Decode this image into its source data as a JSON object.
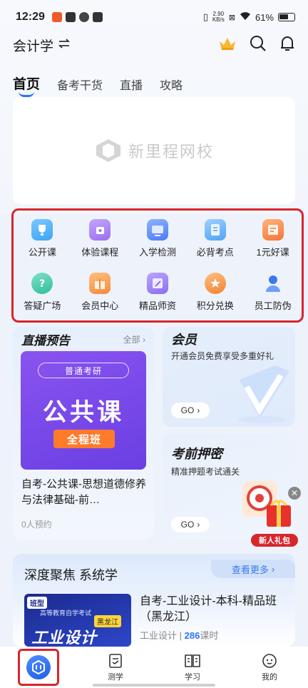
{
  "status_bar": {
    "time": "12:29",
    "net_speed_value": "2.90",
    "net_speed_unit": "KB/s",
    "battery": "61%"
  },
  "header": {
    "subject": "会计学",
    "switch_icon": "swap-arrows-icon",
    "icons": [
      "crown-icon",
      "search-icon",
      "bell-icon"
    ],
    "accent": "#2d72ff"
  },
  "tabs": [
    "首页",
    "备考干货",
    "直播",
    "攻略"
  ],
  "banner": {
    "logo_text": "新里程网校"
  },
  "shortcuts": [
    {
      "label": "公开课",
      "icon": "trophy-icon",
      "color": "#3aa6f5"
    },
    {
      "label": "体验课程",
      "icon": "bag-icon",
      "color": "#9b6ef0"
    },
    {
      "label": "入学检测",
      "icon": "monitor-icon",
      "color": "#4a7bf5"
    },
    {
      "label": "必背考点",
      "icon": "document-icon",
      "color": "#4fa3f6"
    },
    {
      "label": "1元好课",
      "icon": "coupon-icon",
      "color": "#f7763a"
    },
    {
      "label": "答疑广场",
      "icon": "question-bubble-icon",
      "color": "#2fbf9c"
    },
    {
      "label": "会员中心",
      "icon": "gift-box-icon",
      "color": "#f6893a"
    },
    {
      "label": "精品师资",
      "icon": "pen-notebook-icon",
      "color": "#8c6ff1"
    },
    {
      "label": "积分兑换",
      "icon": "star-badge-icon",
      "color": "#f2842f"
    },
    {
      "label": "员工防伪",
      "icon": "person-icon",
      "color": "#3a78f0"
    }
  ],
  "live_preview": {
    "title": "直播预告",
    "all_label": "全部",
    "poster_tag": "普通考研",
    "poster_main": "公共课",
    "poster_button": "全程班",
    "description": "自考-公共课-思想道德修养与法律基础-前…",
    "appointments": "0人预约"
  },
  "member": {
    "title": "会员",
    "subtitle": "开通会员免费享受多重好礼",
    "go_label": "GO"
  },
  "press": {
    "title": "考前押密",
    "subtitle": "精准押题考试通关",
    "go_label": "GO",
    "gift_tag": "新人礼包"
  },
  "focus": {
    "title": "深度聚焦 系统学",
    "more_label": "查看更多",
    "course": {
      "thumb_tag": "班型",
      "thumb_sub": "高等教育自学考试",
      "thumb_region": "黑龙江",
      "thumb_main": "工业设计",
      "title": "自考-工业设计-本科-精品班（黑龙江）",
      "category": "工业设计",
      "hours_value": "286",
      "hours_unit": "课时"
    }
  },
  "bottom_nav": [
    {
      "label": "",
      "icon": "home-logo-icon"
    },
    {
      "label": "测学",
      "icon": "quiz-icon"
    },
    {
      "label": "学习",
      "icon": "book-icon"
    },
    {
      "label": "我的",
      "icon": "profile-icon"
    }
  ]
}
